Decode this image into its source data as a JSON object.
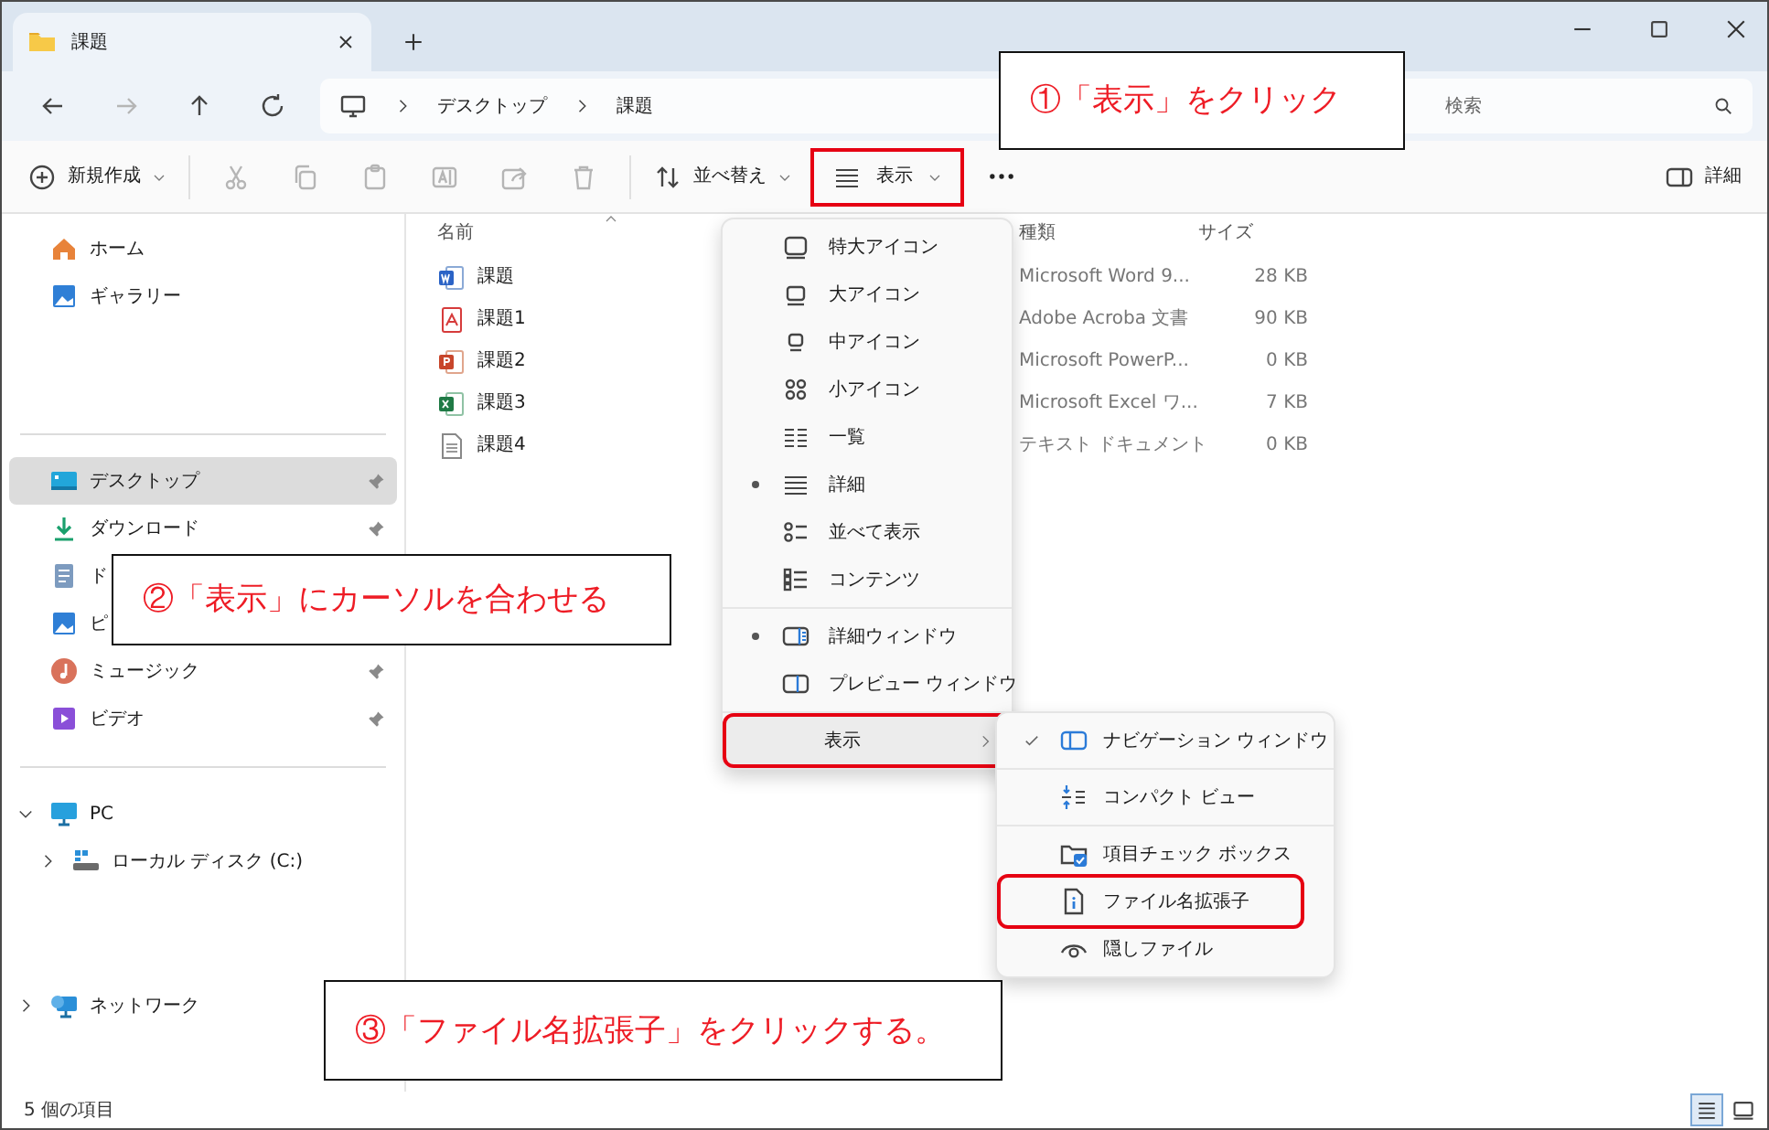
{
  "window": {
    "tab_title": "課題"
  },
  "address_bar": {
    "breadcrumbs": [
      "デスクトップ",
      "課題"
    ],
    "search_placeholder": "検索"
  },
  "toolbar": {
    "new_label": "新規作成",
    "sort_label": "並べ替え",
    "view_label": "表示",
    "view_annotated": true,
    "details_label": "詳細"
  },
  "sidebar": {
    "quick_access": [
      {
        "label": "ホーム",
        "kind": "home",
        "selected": false
      },
      {
        "label": "ギャラリー",
        "kind": "gallery",
        "selected": false
      }
    ],
    "pinned": [
      {
        "label": "デスクトップ",
        "kind": "desktop",
        "selected": true,
        "pinned": true
      },
      {
        "label": "ダウンロード",
        "kind": "download",
        "selected": false,
        "pinned": true
      },
      {
        "label": "ド",
        "kind": "documents",
        "selected": false
      },
      {
        "label": "ピ",
        "kind": "pictures",
        "selected": false
      },
      {
        "label": "ミュージック",
        "kind": "music",
        "selected": false,
        "pinned": true
      },
      {
        "label": "ビデオ",
        "kind": "video",
        "selected": false,
        "pinned": true
      }
    ],
    "tree": [
      {
        "label": "PC",
        "kind": "pc",
        "selected": false,
        "expanded": true,
        "children": [
          {
            "label": "ローカル ディスク (C:)",
            "kind": "disk",
            "selected": false,
            "expanded": false
          }
        ]
      },
      {
        "label": "ネットワーク",
        "kind": "network",
        "selected": false,
        "expanded": false
      }
    ]
  },
  "file_list": {
    "columns": [
      {
        "label": "名前",
        "sorted": true
      },
      {
        "label": "種類"
      },
      {
        "label": "サイズ"
      }
    ],
    "rows": [
      {
        "name": "課題",
        "kind": "word",
        "type": "Microsoft Word 9...",
        "size": "28 KB"
      },
      {
        "name": "課題1",
        "kind": "pdf",
        "type": "Adobe Acroba 文書",
        "size": "90 KB"
      },
      {
        "name": "課題2",
        "kind": "powerpoint",
        "type": "Microsoft PowerP...",
        "size": "0 KB"
      },
      {
        "name": "課題3",
        "kind": "excel",
        "type": "Microsoft Excel ワ...",
        "size": "7 KB"
      },
      {
        "name": "課題4",
        "kind": "text",
        "type": "テキスト ドキュメント",
        "size": "0 KB"
      }
    ]
  },
  "view_menu": {
    "groups": [
      [
        {
          "label": "特大アイコン",
          "kind": "extra-large",
          "selected": false
        },
        {
          "label": "大アイコン",
          "kind": "large",
          "selected": false
        },
        {
          "label": "中アイコン",
          "kind": "medium",
          "selected": false
        },
        {
          "label": "小アイコン",
          "kind": "small",
          "selected": false
        },
        {
          "label": "一覧",
          "kind": "list",
          "selected": false
        },
        {
          "label": "詳細",
          "kind": "details",
          "selected": true
        },
        {
          "label": "並べて表示",
          "kind": "tiles",
          "selected": false
        },
        {
          "label": "コンテンツ",
          "kind": "content",
          "selected": false
        }
      ],
      [
        {
          "label": "詳細ウィンドウ",
          "kind": "details-pane",
          "selected": true
        },
        {
          "label": "プレビュー ウィンドウ",
          "kind": "preview-pane",
          "selected": false
        }
      ],
      [
        {
          "label": "表示",
          "kind": "submenu",
          "highlighted": true,
          "annotated": true
        }
      ]
    ]
  },
  "show_submenu": {
    "groups": [
      [
        {
          "label": "ナビゲーション ウィンドウ",
          "kind": "navigation-pane",
          "checked": true,
          "annotated": false
        }
      ],
      [
        {
          "label": "コンパクト ビュー",
          "kind": "compact",
          "checked": false,
          "annotated": false
        }
      ],
      [
        {
          "label": "項目チェック ボックス",
          "kind": "item-checkbox",
          "checked": false,
          "annotated": false
        },
        {
          "label": "ファイル名拡張子",
          "kind": "extension",
          "checked": false,
          "annotated": true
        },
        {
          "label": "隠しファイル",
          "kind": "hidden",
          "checked": false,
          "annotated": false
        }
      ]
    ]
  },
  "callouts": [
    {
      "text": "①「表示」をクリック"
    },
    {
      "text": "②「表示」にカーソルを合わせる"
    },
    {
      "text": "③「ファイル名拡張子」をクリックする。"
    }
  ],
  "status_bar": {
    "count": "5 個の項目",
    "view_toggles": [
      {
        "kind": "details",
        "selected": true
      },
      {
        "kind": "large-icons",
        "selected": false
      }
    ]
  }
}
